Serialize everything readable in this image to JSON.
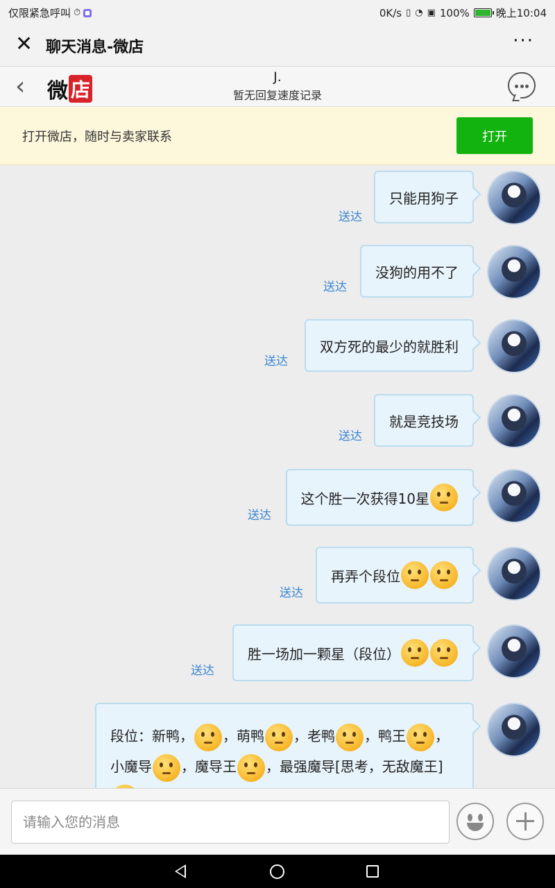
{
  "status_bar": {
    "carrier": "仅限紧急呼叫",
    "speed": "0K/s",
    "battery": "100%",
    "time": "晚上10:04"
  },
  "header": {
    "title": "聊天消息-微店",
    "more": "···"
  },
  "shop": {
    "logo_a": "微",
    "logo_b": "店",
    "peer_name": "J.",
    "peer_sub": "暂无回复速度记录"
  },
  "banner": {
    "text": "打开微店，随时与卖家联系",
    "button": "打开"
  },
  "messages": [
    {
      "text": "只能用狗子",
      "status": "送达",
      "emojis": 0
    },
    {
      "text": "没狗的用不了",
      "status": "送达",
      "emojis": 0
    },
    {
      "text": "双方死的最少的就胜利",
      "status": "送达",
      "emojis": 0
    },
    {
      "text": "就是竞技场",
      "status": "送达",
      "emojis": 0
    },
    {
      "text": "这个胜一次获得10星",
      "status": "送达",
      "emojis": 1
    },
    {
      "text": "再弄个段位",
      "status": "送达",
      "emojis": 2
    },
    {
      "text": "胜一场加一颗星（段位）",
      "status": "送达",
      "emojis": 2
    },
    {
      "parts": [
        "段位：新鸭，",
        "，萌鸭",
        "，老鸭",
        "，鸭王",
        "，小魔导",
        "，魔导王",
        "，最强魔导[思考，无敌魔王]"
      ],
      "emoji_icon": "thinking-face-icon"
    }
  ],
  "input": {
    "placeholder": "请输入您的消息"
  }
}
